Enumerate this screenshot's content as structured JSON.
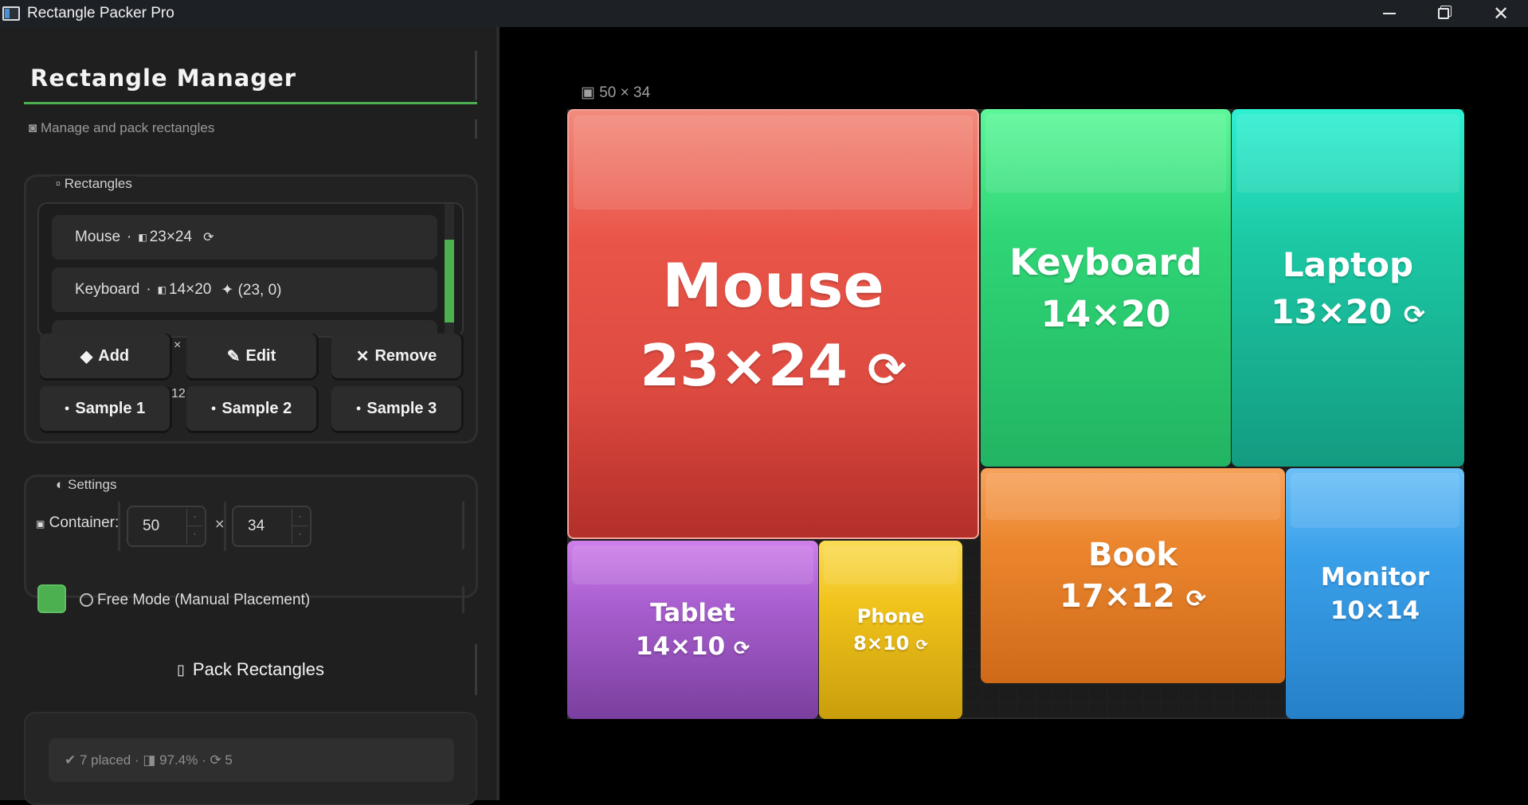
{
  "window": {
    "title": "Rectangle Packer Pro",
    "minimize_icon": "minimize-icon",
    "restore_icon": "restore-icon",
    "close_icon": "close-icon"
  },
  "sidebar": {
    "title": "Rectangle Manager",
    "subtitle": "Manage and pack rectangles",
    "subtitle_icon": "◙",
    "rectangles_group": {
      "title": "Rectangles",
      "title_icon": "▫",
      "items": [
        {
          "name": "Mouse",
          "sep": "·",
          "size_icon": "◧",
          "size": "23×24",
          "extra": "⟳"
        },
        {
          "name": "Keyboard",
          "sep": "·",
          "size_icon": "◧",
          "size": "14×20",
          "extra": "✦ (23, 0)"
        }
      ],
      "overflow_x": "×",
      "overflow_12": "12",
      "buttons": {
        "add": {
          "icon": "◆",
          "label": "Add"
        },
        "edit": {
          "icon": "✎",
          "label": "Edit"
        },
        "remove": {
          "icon": "✕",
          "label": "Remove"
        },
        "sample1": {
          "icon": "●",
          "label": "Sample 1"
        },
        "sample2": {
          "icon": "●",
          "label": "Sample 2"
        },
        "sample3": {
          "icon": "●",
          "label": "Sample 3"
        }
      }
    },
    "settings_group": {
      "title": "Settings",
      "title_icon": "◐",
      "container_icon": "▣",
      "container_label": "Container:",
      "width": "50",
      "height": "34",
      "times": "×",
      "free_mode_label": "Free Mode (Manual Placement)",
      "free_mode_checked": false,
      "accent_color": "#4caf50"
    },
    "pack_button": {
      "icon": "▯",
      "label": "Pack Rectangles"
    },
    "status": "✔ 7 placed · ◨ 97.4% · ⟳ 5"
  },
  "canvas": {
    "label": "▣ 50 × 34",
    "container": {
      "w": 50,
      "h": 34
    },
    "rectangles": [
      {
        "name": "Mouse",
        "dims": "23×24",
        "rotated": true,
        "color": "#e8524a"
      },
      {
        "name": "Keyboard",
        "dims": "14×20",
        "rotated": false,
        "color": "#2fcf73"
      },
      {
        "name": "Laptop",
        "dims": "13×20",
        "rotated": true,
        "color": "#1cc9a4"
      },
      {
        "name": "Book",
        "dims": "17×12",
        "rotated": true,
        "color": "#ec8a2f"
      },
      {
        "name": "Monitor",
        "dims": "10×14",
        "rotated": false,
        "color": "#3ea0e8"
      },
      {
        "name": "Tablet",
        "dims": "14×10",
        "rotated": true,
        "color": "#ad5fd0"
      },
      {
        "name": "Phone",
        "dims": "8×10",
        "rotated": true,
        "color": "#f0c420"
      }
    ]
  }
}
